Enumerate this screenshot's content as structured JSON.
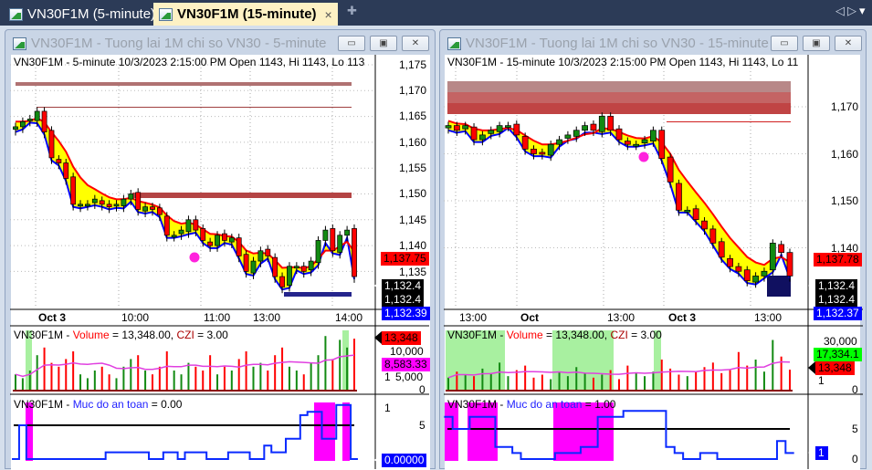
{
  "tabs": [
    {
      "label": "VN30F1M (5-minute)",
      "active": false
    },
    {
      "label": "VN30F1M (15-minute)",
      "active": true
    }
  ],
  "tab_close": "×",
  "tab_add": "✚",
  "nav": {
    "prev": "◁",
    "next": "▷",
    "menu": "▾"
  },
  "windows": [
    {
      "title": "VN30F1M - Tuong lai 1M chi so VN30 - 5-minute",
      "header": "VN30F1M - 5-minute 10/3/2023 2:15:00 PM Open 1143, Hi 1143, Lo 113",
      "price_ticks": [
        "1,175",
        "1,170",
        "1,165",
        "1,160",
        "1,155",
        "1,150",
        "1,145",
        "1,140",
        "1,135"
      ],
      "x_labels": [
        "Oct 3",
        "10:00",
        "11:00",
        "13:00",
        "14:00"
      ],
      "badges": {
        "last": "1,137.75",
        "b1": "1,132.4",
        "b2": "1,132.4",
        "b3": "1,132.39"
      },
      "volume_header": {
        "sym": "VN30F1M - ",
        "vol": "Volume",
        "eq": " = 13,348.00, ",
        "czi": "CZI",
        "eq2": " = 3.00"
      },
      "volume_ticks": [
        "10,000",
        "1",
        "5,000",
        "0"
      ],
      "volume_badges": {
        "vol": "13,348",
        "ma": "8,583.33"
      },
      "safety_header": {
        "sym": "VN30F1M - ",
        "name": "Muc do an toan",
        "eq": " = 0.00"
      },
      "safety_ticks": [
        "1",
        "5"
      ],
      "safety_badge": "0.00000"
    },
    {
      "title": "VN30F1M - Tuong lai 1M chi so VN30 - 15-minute",
      "header": "VN30F1M - 15-minute 10/3/2023 2:15:00 PM Open 1143, Hi 1143, Lo 11",
      "price_ticks": [
        "1,170",
        "1,160",
        "1,150",
        "1,140"
      ],
      "x_labels": [
        "13:00",
        "Oct",
        "13:00",
        "Oct 3",
        "13:00"
      ],
      "badges": {
        "last": "1,137.78",
        "b1": "1,132.4",
        "b2": "1,132.4",
        "b3": "1,132.37"
      },
      "volume_header": {
        "sym": "VN30F1M - ",
        "vol": "Volume",
        "eq": " = 13,348.00, ",
        "czi": "CZI",
        "eq2": " = 3.00"
      },
      "volume_ticks": [
        "30,000",
        "1",
        "0"
      ],
      "volume_badges": {
        "vol": "13,348",
        "ma": "17,334.1"
      },
      "safety_header": {
        "sym": "VN30F1M - ",
        "name": "Muc do an toan",
        "eq": " = 1.00"
      },
      "safety_ticks": [
        "5",
        "0"
      ],
      "safety_badge": "1"
    }
  ],
  "colors": {
    "up": "#128a12",
    "down": "#ff0000",
    "ma": "#ff0000",
    "band": "#ffff00",
    "low": "#0000ff",
    "safety": "#0a2aff",
    "zone": "#ff00ff",
    "vol_zone": "#a8f0a0"
  },
  "chart_data": [
    {
      "type": "candlestick",
      "timeframe": "5-minute",
      "closes": [
        1163,
        1164,
        1164.5,
        1166,
        1162,
        1157,
        1156,
        1153,
        1148,
        1148,
        1148,
        1149,
        1148,
        1147.5,
        1148,
        1149,
        1150,
        1147,
        1147.5,
        1147,
        1146,
        1142,
        1142,
        1143,
        1145,
        1143,
        1141,
        1140,
        1142,
        1141,
        1141.5,
        1138,
        1135,
        1137,
        1139,
        1138,
        1134,
        1132,
        1136,
        1136,
        1135,
        1137,
        1141,
        1143,
        1139,
        1142,
        1143,
        1134
      ],
      "volume_thousands": [
        4,
        3,
        5,
        9,
        11,
        7,
        6,
        8,
        10,
        4,
        3,
        5,
        6,
        4,
        3,
        6,
        8,
        9,
        5,
        4,
        6,
        10,
        5,
        4,
        7,
        6,
        5,
        9,
        4,
        6,
        5,
        8,
        10,
        6,
        7,
        5,
        9,
        11,
        6,
        5,
        4,
        7,
        9,
        14,
        8,
        13,
        11,
        13.3
      ],
      "safety": [
        0,
        5,
        0,
        0,
        0,
        0,
        0,
        0,
        0,
        0,
        0,
        0,
        0,
        1,
        1,
        1,
        1,
        1,
        1,
        0,
        0,
        1,
        1,
        0,
        1,
        1,
        1,
        0,
        0,
        0,
        1,
        1,
        1,
        0,
        0,
        2,
        1,
        1,
        3,
        3,
        6.5,
        7,
        7,
        3,
        3,
        8,
        8,
        0
      ],
      "ylim": [
        1132,
        1177
      ]
    },
    {
      "type": "candlestick",
      "timeframe": "15-minute",
      "closes": [
        1166,
        1165,
        1166,
        1163,
        1164,
        1165,
        1166,
        1166,
        1164,
        1161,
        1160,
        1160,
        1162,
        1163,
        1164,
        1165,
        1166,
        1165,
        1168,
        1165,
        1163,
        1162,
        1162,
        1163,
        1165,
        1159,
        1154,
        1148,
        1148,
        1146,
        1144,
        1141,
        1138,
        1136,
        1135,
        1133,
        1134,
        1135,
        1141,
        1139,
        1134
      ],
      "volume_thousands": [
        8,
        12,
        10,
        9,
        14,
        11,
        18,
        9,
        13,
        16,
        8,
        10,
        7,
        12,
        9,
        15,
        11,
        8,
        10,
        13,
        7,
        16,
        11,
        9,
        12,
        20,
        14,
        10,
        9,
        12,
        15,
        18,
        11,
        13,
        25,
        16,
        20,
        12,
        33,
        22,
        13.3
      ],
      "safety": [
        7,
        5,
        5,
        7,
        7,
        7,
        2,
        2,
        1,
        0,
        0,
        0,
        0,
        1,
        1,
        1,
        2,
        2,
        7,
        7,
        7,
        8,
        8,
        8,
        8,
        8,
        2,
        1,
        0,
        0,
        1,
        1,
        0,
        0,
        0,
        0,
        0,
        0,
        0,
        3,
        1
      ],
      "ylim": [
        1130,
        1175
      ]
    }
  ]
}
